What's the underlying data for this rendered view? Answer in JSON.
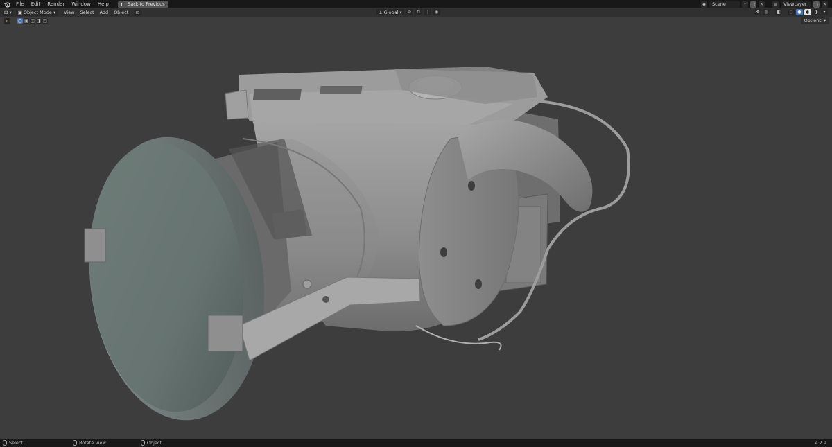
{
  "topbar": {
    "menus": [
      "File",
      "Edit",
      "Render",
      "Window",
      "Help"
    ],
    "back_button": "Back to Previous",
    "scene": "Scene",
    "view_layer": "ViewLayer"
  },
  "header": {
    "mode": "Object Mode",
    "menus": [
      "View",
      "Select",
      "Add",
      "Object"
    ],
    "orientation": "Global"
  },
  "toolrow": {
    "options": "Options"
  },
  "status": {
    "select": "Select",
    "rotate": "Rotate View",
    "object": "Object",
    "version": "4.2.9"
  },
  "colors": {
    "background": "#3d3d3d",
    "topbar": "#181818",
    "accent": "#4772b3"
  }
}
